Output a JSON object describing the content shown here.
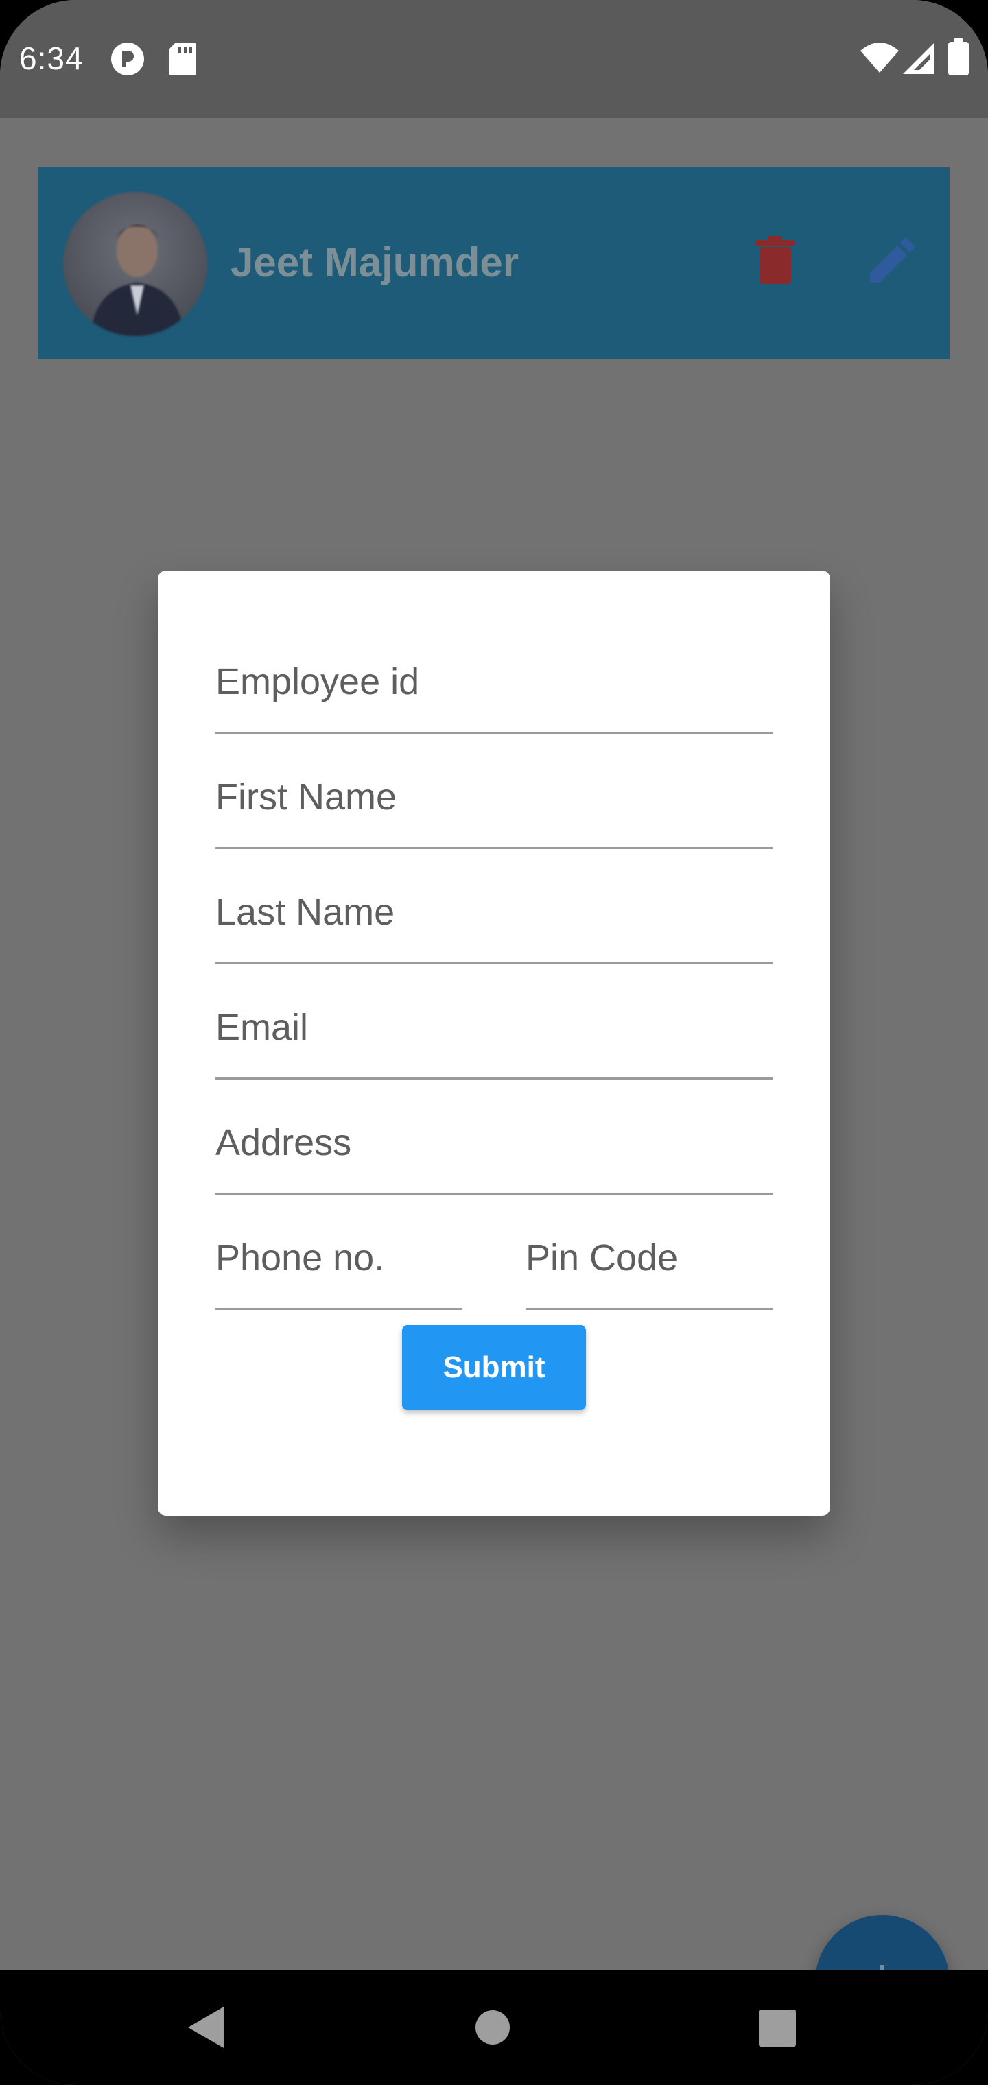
{
  "status_bar": {
    "time": "6:34",
    "icons": [
      "app-notification-icon",
      "sd-card-icon",
      "wifi-icon",
      "cell-signal-icon",
      "battery-icon"
    ]
  },
  "employee": {
    "name": "Jeet Majumder",
    "card_color": "#1d5b79",
    "delete_color": "#8b2a2a",
    "edit_color": "#2f5a9e"
  },
  "dialog": {
    "fields": {
      "employee_id": "Employee id",
      "first_name": "First Name",
      "last_name": "Last Name",
      "email": "Email",
      "address": "Address",
      "phone": "Phone no.",
      "pin_code": "Pin Code"
    },
    "submit_label": "Submit",
    "submit_color": "#2196f3"
  },
  "fab": {
    "icon": "plus-icon",
    "color": "#174a72"
  },
  "nav": {
    "icons": [
      "back-icon",
      "home-icon",
      "recents-icon"
    ]
  }
}
